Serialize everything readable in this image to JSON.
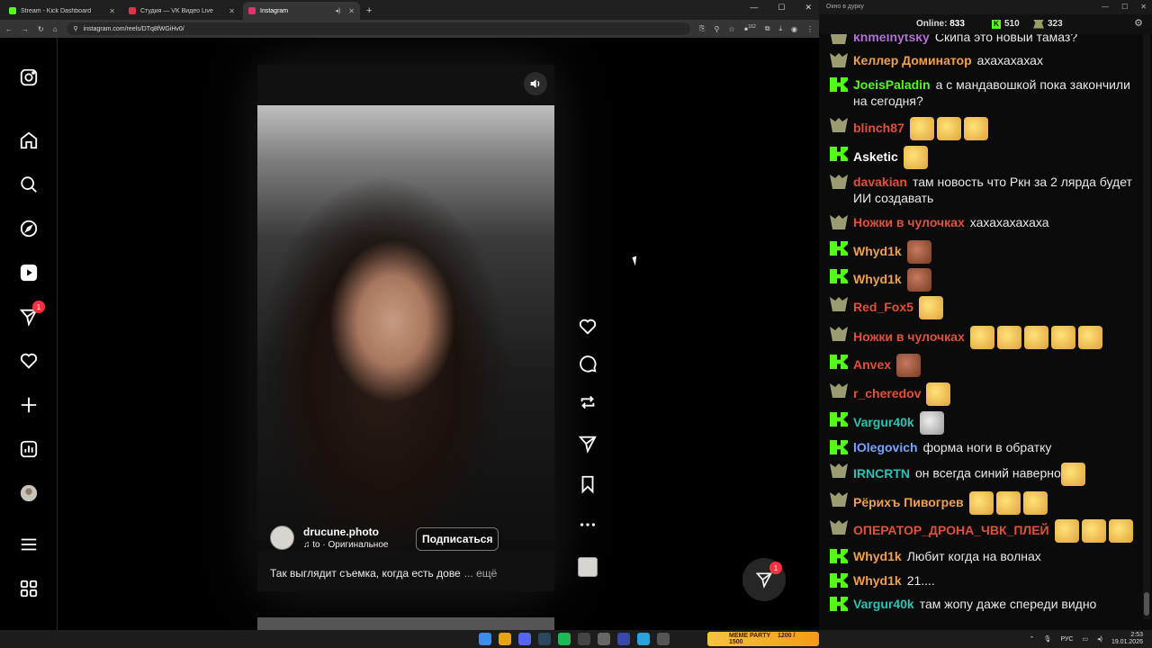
{
  "browser": {
    "tabs": [
      {
        "label": "Stream - Kick Dashboard",
        "color": "#53fc18"
      },
      {
        "label": "Студия — VK Видео Live",
        "color": "#e6314a"
      },
      {
        "label": "Instagram",
        "color": "#e1306c"
      }
    ],
    "url": "instagram.com/reels/DTq8fWGiHv0/",
    "extension_badge": "162"
  },
  "instagram": {
    "notification_count": "1",
    "reel": {
      "author": "drucune.photo",
      "audio": "to · Оригинальное",
      "follow_label": "Подписаться",
      "caption": "Так выглядит съемка, когда есть дове",
      "caption_more": "... ещё"
    },
    "dm_count": "1"
  },
  "chat": {
    "window_title": "Окно в дурку",
    "online_label": "Online:",
    "online_count": "833",
    "stat1": "510",
    "stat2": "323",
    "messages": [
      {
        "badge": "crown",
        "name": "khmelnytsky",
        "color": "#b46fd8",
        "text": "Скипа это новый тамаз?",
        "emotes": []
      },
      {
        "badge": "crown",
        "name": "Келлер Доминатор",
        "color": "#f0a04b",
        "text": "ахахахахах",
        "emotes": []
      },
      {
        "badge": "kick",
        "name": "JoeisPaladin",
        "color": "#53fc18",
        "text": "а с мандавошкой пока закончили на сегодня?",
        "emotes": []
      },
      {
        "badge": "crown",
        "name": "blinch87",
        "color": "#e0503c",
        "text": "",
        "emotes": [
          "y",
          "y",
          "y"
        ]
      },
      {
        "badge": "kick",
        "name": "Asketic",
        "color": "#ffffff",
        "text": "",
        "emotes": [
          "y"
        ]
      },
      {
        "badge": "crown",
        "name": "davakian",
        "color": "#e0503c",
        "text": "там новость что Ркн за 2 лярда будет ИИ создавать",
        "emotes": []
      },
      {
        "badge": "crown",
        "name": "Ножки в чулочках",
        "color": "#e0503c",
        "text": "хахахахахаха",
        "emotes": []
      },
      {
        "badge": "kick",
        "name": "Whyd1k",
        "color": "#f0a04b",
        "text": "",
        "emotes": [
          "r"
        ]
      },
      {
        "badge": "kick",
        "name": "Whyd1k",
        "color": "#f0a04b",
        "text": "",
        "emotes": [
          "r"
        ]
      },
      {
        "badge": "crown",
        "name": "Red_Fox5",
        "color": "#e0503c",
        "text": "",
        "emotes": [
          "y"
        ]
      },
      {
        "badge": "crown",
        "name": "Ножки в чулочках",
        "color": "#e0503c",
        "text": "",
        "emotes": [
          "y",
          "y",
          "y",
          "y",
          "y"
        ]
      },
      {
        "badge": "kick",
        "name": "Anvex",
        "color": "#e0503c",
        "text": "",
        "emotes": [
          "r"
        ]
      },
      {
        "badge": "crown",
        "name": "r_cheredov",
        "color": "#e0503c",
        "text": "",
        "emotes": [
          "y"
        ]
      },
      {
        "badge": "kick",
        "name": "Vargur40k",
        "color": "#27c4b5",
        "text": "",
        "emotes": [
          "g"
        ]
      },
      {
        "badge": "kick",
        "name": "lOlegovich",
        "color": "#7aa2ff",
        "text": "форма ноги в обратку",
        "emotes": []
      },
      {
        "badge": "crown",
        "name": "IRNCRTN",
        "color": "#27c4b5",
        "text": "он всегда синий наверно",
        "emotes": [
          "y"
        ]
      },
      {
        "badge": "crown",
        "name": "Рёрихъ Пивогрев",
        "color": "#f0a04b",
        "text": "",
        "emotes": [
          "y",
          "y",
          "y"
        ]
      },
      {
        "badge": "crown",
        "name": "ОПЕРАТОР_ДРОНА_ЧВК_ПЛЕЙ",
        "color": "#e0503c",
        "text": "",
        "emotes": [
          "y",
          "y",
          "y"
        ]
      },
      {
        "badge": "kick",
        "name": "Whyd1k",
        "color": "#f0a04b",
        "text": "Любит когда на волнах",
        "emotes": []
      },
      {
        "badge": "kick",
        "name": "Whyd1k",
        "color": "#f0a04b",
        "text": "21....",
        "emotes": []
      },
      {
        "badge": "kick",
        "name": "Vargur40k",
        "color": "#27c4b5",
        "text": "там жопу даже спереди видно",
        "emotes": []
      }
    ]
  },
  "taskbar": {
    "widget_label": "MEME PARTY",
    "widget_value": "1200 / 1500",
    "lang": "РУС",
    "time": "2:53",
    "date": "19.01.2026"
  }
}
